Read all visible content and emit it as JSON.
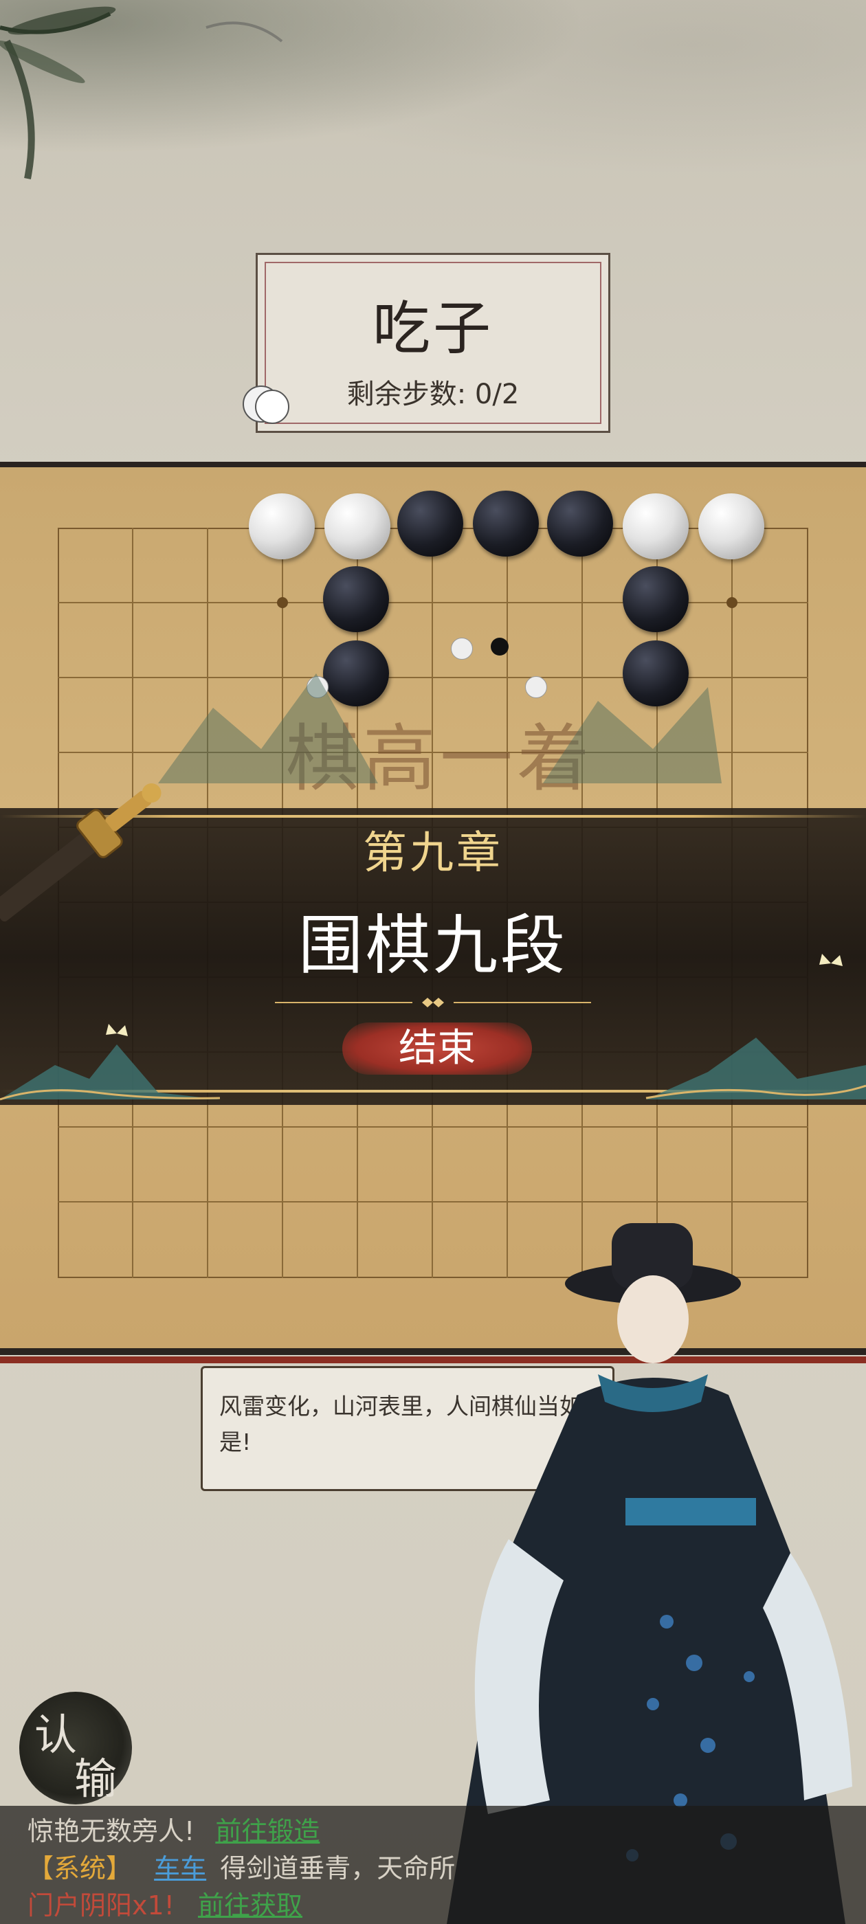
{
  "challenge": {
    "title": "吃子",
    "steps_label": "剩余步数: 0/2"
  },
  "banner": {
    "watermark": "棋高一着",
    "chapter": "第九章",
    "rank": "围棋九段",
    "end_button": "结束"
  },
  "dialogue": {
    "text": "风雷变化，山河表里，人间棋仙当如是!"
  },
  "surrender": {
    "label_1": "认",
    "label_2": "输"
  },
  "chat": {
    "line1": {
      "text": "惊艳无数旁人!",
      "link": "前往锻造"
    },
    "line2": {
      "tag": "【系统】",
      "user": "车车",
      "text": "得剑道垂青，天命所"
    },
    "line3": {
      "text": "门户阴阳x1!",
      "link": "前往获取"
    }
  },
  "colors": {
    "board": "#d2b27a",
    "gold": "#f0d58e",
    "end_button": "#b23d31",
    "chat_link": "#3fa24a"
  }
}
